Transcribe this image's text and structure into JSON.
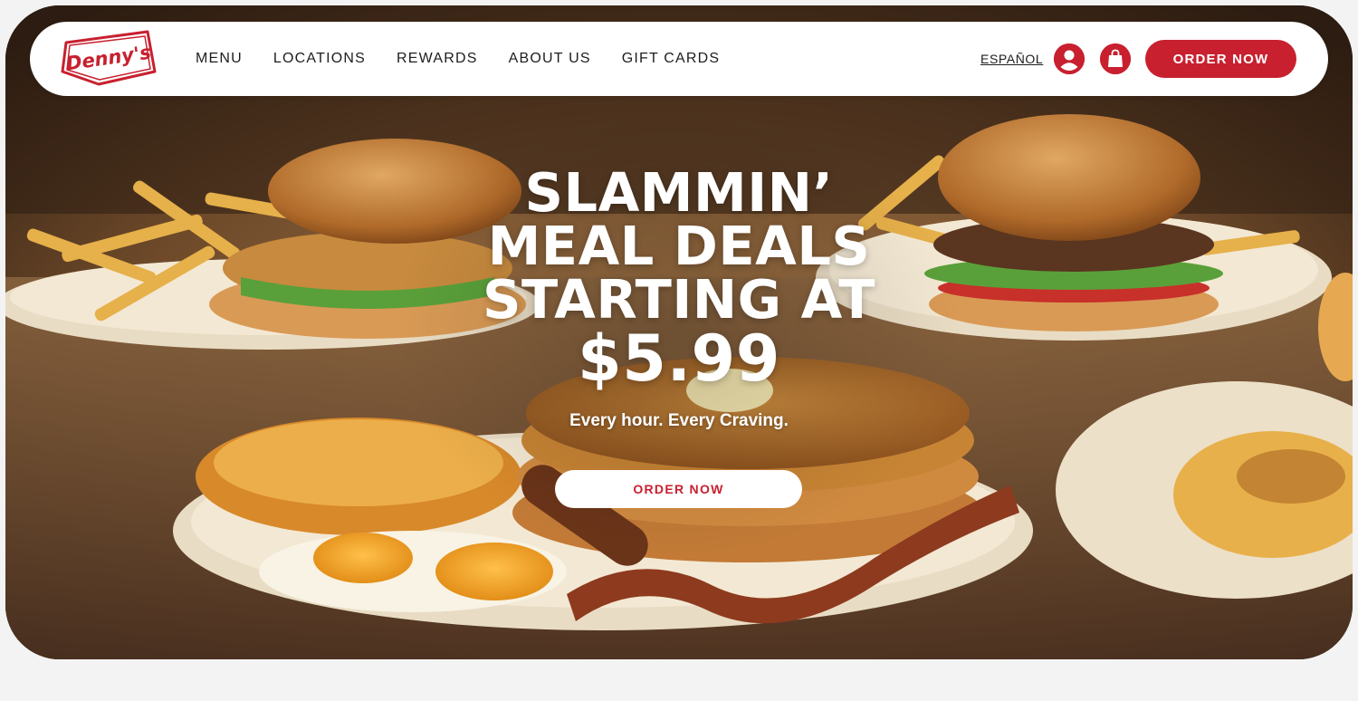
{
  "brand": {
    "logo_text": "Denny's",
    "primary_color": "#c8202f"
  },
  "nav": {
    "links": [
      {
        "label": "MENU"
      },
      {
        "label": "LOCATIONS"
      },
      {
        "label": "REWARDS"
      },
      {
        "label": "ABOUT US"
      },
      {
        "label": "GIFT CARDS"
      }
    ],
    "language": "ESPAÑOL",
    "account_icon": "user-icon",
    "bag_icon": "shopping-bag-icon",
    "order_label": "ORDER NOW"
  },
  "hero": {
    "headline_lines": [
      "SLAMMIN’",
      "MEAL DEALS",
      "STARTING AT"
    ],
    "price": "$5.99",
    "tagline": "Every hour. Every Craving.",
    "cta_label": "ORDER NOW"
  }
}
